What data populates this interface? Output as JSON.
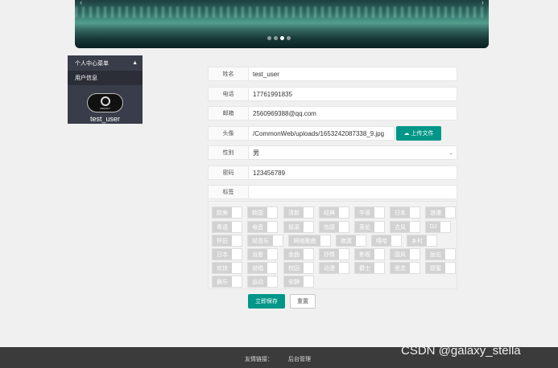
{
  "side_menu": {
    "title": "个人中心菜单",
    "item": "用户信息",
    "avatar_brand": "UBISOFT",
    "username": "test_user"
  },
  "form": {
    "name": {
      "label": "姓名",
      "value": "test_user"
    },
    "phone": {
      "label": "电话",
      "value": "17761991835"
    },
    "email": {
      "label": "邮箱",
      "value": "2560969388@qq.com"
    },
    "avatar": {
      "label": "头像",
      "value": "/CommonWeb/uploads/1653242087338_9.jpg",
      "button": "上传文件"
    },
    "gender": {
      "label": "性别",
      "value": "男"
    },
    "password": {
      "label": "密码",
      "value": "123456789"
    },
    "tags": {
      "label": "标签"
    }
  },
  "tags": [
    "欧美",
    "韩国",
    "清新",
    "经典",
    "华语",
    "日本",
    "浪漫",
    "粤语",
    "电音",
    "摇滚",
    "伤感",
    "英伦",
    "古风",
    "DJ",
    "怀旧",
    "轻音乐",
    "网络歌曲",
    "寂寞",
    "嘻哈",
    "乡村",
    "日本",
    "治愈",
    "金曲",
    "抒情",
    "影视",
    "国风",
    "励志",
    "欢快",
    "说唱",
    "校园",
    "动漫",
    "爵士",
    "思念",
    "甜蜜",
    "器乐",
    "动漫",
    "运动",
    "安静"
  ],
  "buttons": {
    "save": "立即保存",
    "reset": "重置"
  },
  "footer": {
    "links_label": "友情链接：",
    "admin": "后台管理"
  },
  "watermark": "CSDN @galaxy_stella",
  "colors": {
    "accent": "#009688",
    "menu": "#393d49"
  }
}
